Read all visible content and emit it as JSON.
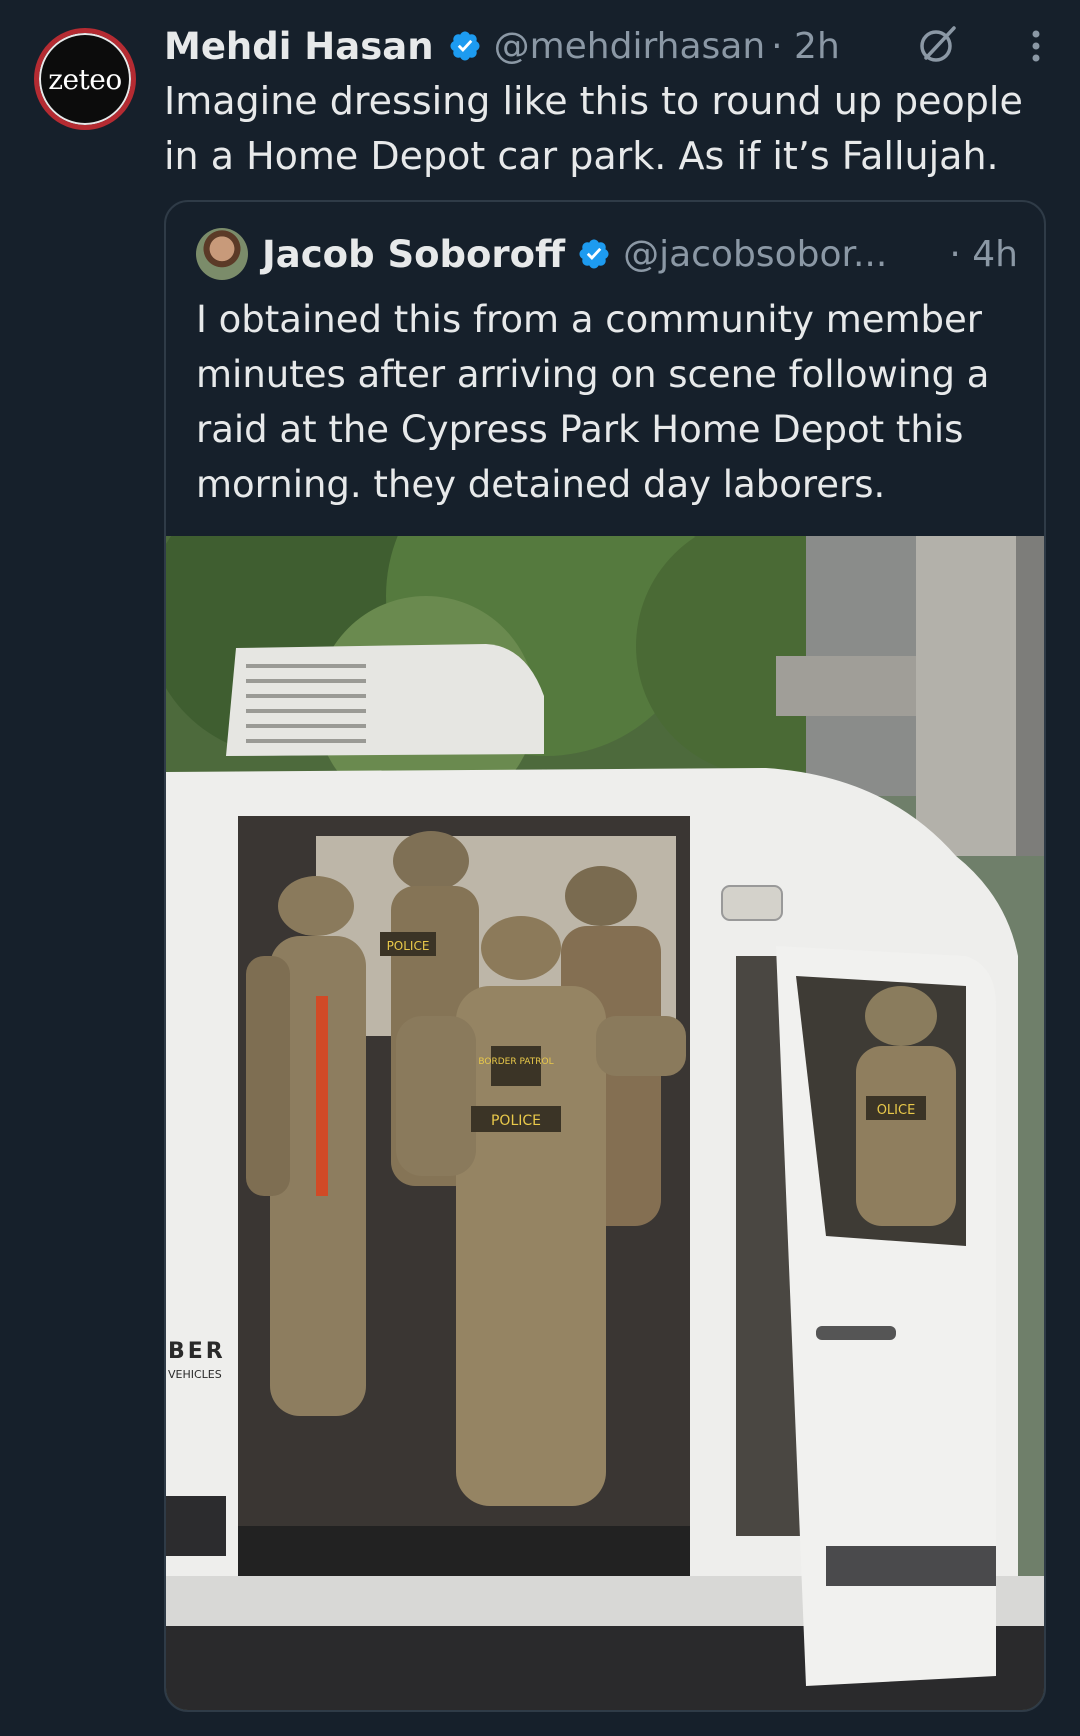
{
  "tweet": {
    "avatar_text": "zeteo",
    "name": "Mehdi Hasan",
    "handle": "@mehdirhasan",
    "time": "· 2h",
    "text": "Imagine dressing like this to round up people in a Home Depot car park. As if it’s Fallujah."
  },
  "quote": {
    "name": "Jacob Soboroff",
    "handle": "@jacobsobor...",
    "time": "· 4h",
    "text": "I obtained this from a community member minutes after arriving on scene following a raid at the Cypress Park Home Depot this morning. they detained day laborers."
  },
  "photo": {
    "patch_police_1": "POLICE",
    "patch_border": "BORDER PATROL",
    "patch_police_2": "POLICE",
    "patch_police_3": "OLICE",
    "van_brand": "BER",
    "van_sub": "VEHICLES"
  },
  "colors": {
    "background": "#16202b",
    "verified": "#1d9bf0",
    "secondary_text": "#8b98a5",
    "border": "#2f3b47"
  },
  "icons": {
    "verified": "verified-badge-icon",
    "grok": "grok-icon",
    "more": "more-options-icon"
  }
}
